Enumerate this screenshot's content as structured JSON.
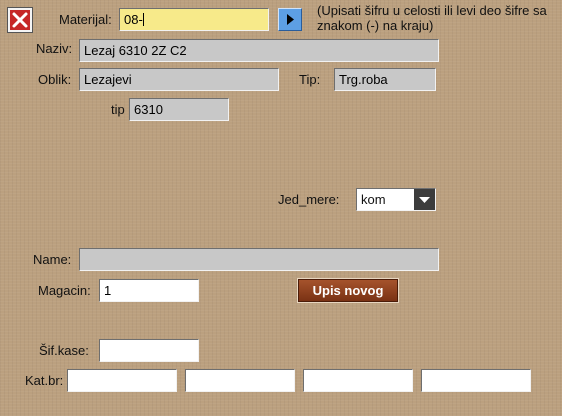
{
  "header": {
    "materijal_label": "Materijal:",
    "materijal_value": "08-",
    "note": "(Upisati šifru u celosti ili levi deo šifre sa znakom (-) na kraju)"
  },
  "fields": {
    "naziv_label": "Naziv:",
    "naziv_value": "Lezaj 6310 2Z C2",
    "oblik_label": "Oblik:",
    "oblik_value": "Lezajevi",
    "tip_label": "Tip:",
    "tip_value": "Trg.roba",
    "tip2_label": "tip",
    "tip2_value": "6310",
    "jed_mere_label": "Jed_mere:",
    "jed_mere_value": "kom",
    "name_label": "Name:",
    "name_value": "",
    "magacin_label": "Magacin:",
    "magacin_value": "1",
    "sif_kase_label": "Šif.kase:",
    "sif_kase_value": "",
    "kat_br_label": "Kat.br:",
    "kat_br_values": [
      "",
      "",
      "",
      ""
    ]
  },
  "buttons": {
    "upis_novog": "Upis novog"
  },
  "icons": {
    "close": "close-icon",
    "arrow": "play-arrow-icon",
    "dropdown": "chevron-down-icon"
  },
  "colors": {
    "background": "#bba07f",
    "highlight_field": "#f7ea8a",
    "disabled_field": "#c8c8c8",
    "action_button": "#8b3f1c",
    "arrow_button": "#5d9fe4",
    "close_button": "#c62828"
  }
}
